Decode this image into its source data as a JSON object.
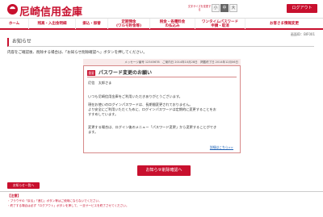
{
  "header": {
    "brand": "尼崎信用金庫",
    "font_size_label": "文字サイズを変更する",
    "font_sizes": [
      "小",
      "中",
      "大"
    ],
    "logout_label": "ログアウト"
  },
  "nav": {
    "items": [
      {
        "label": "ホーム"
      },
      {
        "label": "残高・入出金明細"
      },
      {
        "label": "振込・振替"
      },
      {
        "label": "定期預金",
        "sub": "(ワルモ貯金等)"
      },
      {
        "label": "税金・各種料金",
        "sub": "の払込み"
      },
      {
        "label": "ワンタイムパスワード",
        "sub": "申請・取消"
      },
      {
        "label": "お客さま情報変更"
      }
    ]
  },
  "page": {
    "page_id": "画面ID：BIF001",
    "section_title": "お知らせ",
    "intro": "内容をご確認後、削除する場合は、「お知らせ削除確認へ」ボタンを押してください。"
  },
  "message": {
    "meta": "メッセージ番号 12345678　ご案内日 2014年10月28日　掲載終了日 2014年12月06日",
    "badge": "重要",
    "title": "パスワード変更のお願い",
    "addressee": "尼信　太郎さま",
    "paragraphs": [
      "いつも尼崎信用金庫をご利用いただきありがとうございます。",
      "現在お使いのログインパスワードは、長期間変更されておりません。",
      "より安全にご利用いただくために、ログインパスワードは定期的に変更することをお",
      "すすめしています。",
      "変更する場合は、ログイン後のメニュー「パスワード変更」から変更することができ",
      "ます。"
    ],
    "details_link": "詳細はこちら>>"
  },
  "actions": {
    "confirm_label": "お知らせ削除確認へ",
    "back_label": "お知らせ一覧へ"
  },
  "notes": {
    "title": "【注意】",
    "lines": [
      "・ブラウザの「戻る」「進む」ボタン等はご使用にならないでください。",
      "・終了する場合は必ず「ログアウト」ボタンを押して、一旦サービスを終了させてください。"
    ]
  }
}
